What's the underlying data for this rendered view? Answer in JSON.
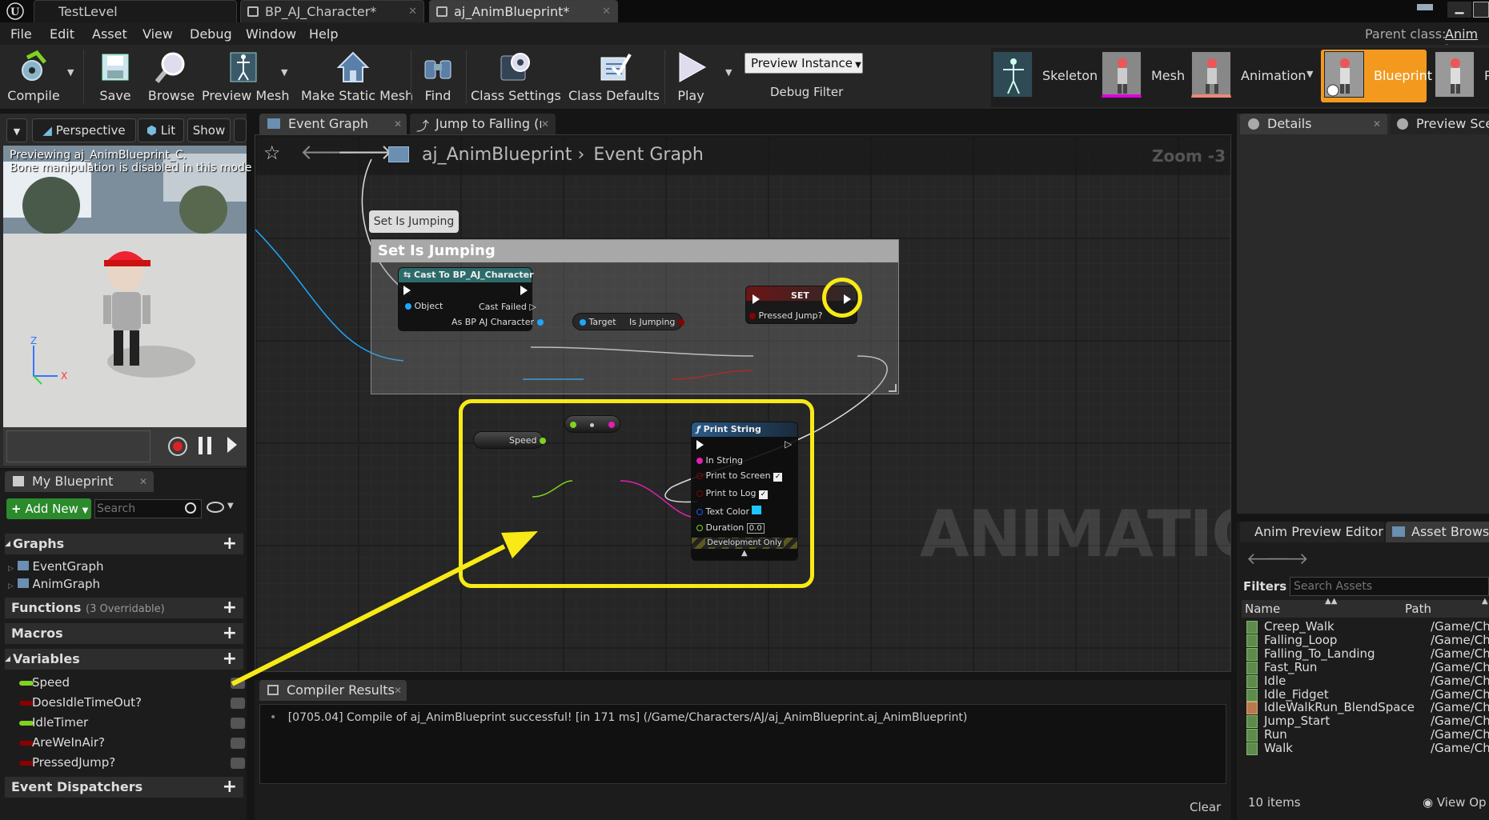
{
  "titlebar": {
    "tabs": [
      "TestLevel",
      "BP_AJ_Character*",
      "aj_AnimBlueprint*"
    ],
    "parent_class_label": "Parent class:",
    "parent_class_value": "Anim In"
  },
  "menu": [
    "File",
    "Edit",
    "Asset",
    "View",
    "Debug",
    "Window",
    "Help"
  ],
  "toolbar": {
    "compile": "Compile",
    "save": "Save",
    "browse": "Browse",
    "preview_mesh": "Preview Mesh",
    "make_static_mesh": "Make Static Mesh",
    "find": "Find",
    "class_settings": "Class Settings",
    "class_defaults": "Class Defaults",
    "play": "Play",
    "preview_instance": "Preview Instance",
    "debug_filter": "Debug Filter"
  },
  "modes": [
    "Skeleton",
    "Mesh",
    "Animation",
    "Blueprint",
    "P"
  ],
  "viewport": {
    "perspective": "Perspective",
    "lit": "Lit",
    "show": "Show",
    "info_line1": "Previewing aj_AnimBlueprint_C.",
    "info_line2": "Bone manipulation is disabled in this mode"
  },
  "my_blueprint": {
    "tab": "My Blueprint",
    "add_new": "Add New",
    "search_placeholder": "Search",
    "graphs": "Graphs",
    "event_graph": "EventGraph",
    "anim_graph": "AnimGraph",
    "functions": "Functions",
    "functions_note": "(3 Overridable)",
    "macros": "Macros",
    "variables": "Variables",
    "vars": [
      {
        "name": "Speed",
        "color": "#7ed321"
      },
      {
        "name": "DoesIdleTimeOut?",
        "color": "#8b0000"
      },
      {
        "name": "IdleTimer",
        "color": "#7ed321"
      },
      {
        "name": "AreWeInAir?",
        "color": "#8b0000"
      },
      {
        "name": "PressedJump?",
        "color": "#8b0000"
      }
    ],
    "event_dispatchers": "Event Dispatchers"
  },
  "graph": {
    "tabs": [
      "Event Graph",
      "Jump to Falling (r"
    ],
    "breadcrumb_root": "aj_AnimBlueprint",
    "breadcrumb_leaf": "Event Graph",
    "zoom": "Zoom -3",
    "comment_bubble": "Set Is Jumping",
    "comment_title": "Set Is Jumping",
    "cast_node_title": "Cast To BP_AJ_Character",
    "cast_pin_object": "Object",
    "cast_pin_failed": "Cast Failed",
    "cast_pin_as": "As BP AJ Character",
    "getter_target": "Target",
    "getter_is_jumping": "Is Jumping",
    "set_node_title": "SET",
    "set_pin": "Pressed Jump?",
    "speed_node": "Speed",
    "print_title": "Print String",
    "print_in_string": "In String",
    "print_to_screen": "Print to Screen",
    "print_to_log": "Print to Log",
    "text_color": "Text Color",
    "duration": "Duration",
    "duration_value": "0.0",
    "dev_only": "Development Only",
    "watermark": "ANIMATION",
    "highlight_color": "#f7ea16"
  },
  "compiler": {
    "tab": "Compiler Results",
    "message": "[0705.04] Compile of aj_AnimBlueprint successful! [in 171 ms] (/Game/Characters/AJ/aj_AnimBlueprint.aj_AnimBlueprint)",
    "clear": "Clear"
  },
  "details": {
    "tab_details": "Details",
    "tab_preview": "Preview Scene"
  },
  "assets": {
    "tab_anim_preview": "Anim Preview Editor",
    "tab_asset_browser": "Asset Browser",
    "filters": "Filters",
    "search_placeholder": "Search Assets",
    "col_name": "Name",
    "col_path": "Path",
    "rows": [
      {
        "name": "Creep_Walk",
        "path": "/Game/Ch"
      },
      {
        "name": "Falling_Loop",
        "path": "/Game/Ch"
      },
      {
        "name": "Falling_To_Landing",
        "path": "/Game/Ch"
      },
      {
        "name": "Fast_Run",
        "path": "/Game/Ch"
      },
      {
        "name": "Idle",
        "path": "/Game/Ch"
      },
      {
        "name": "Idle_Fidget",
        "path": "/Game/Ch"
      },
      {
        "name": "IdleWalkRun_BlendSpace",
        "path": "/Game/Ch"
      },
      {
        "name": "Jump_Start",
        "path": "/Game/Ch"
      },
      {
        "name": "Run",
        "path": "/Game/Ch"
      },
      {
        "name": "Walk",
        "path": "/Game/Ch"
      }
    ],
    "count": "10 items",
    "view_options": "View Op"
  }
}
